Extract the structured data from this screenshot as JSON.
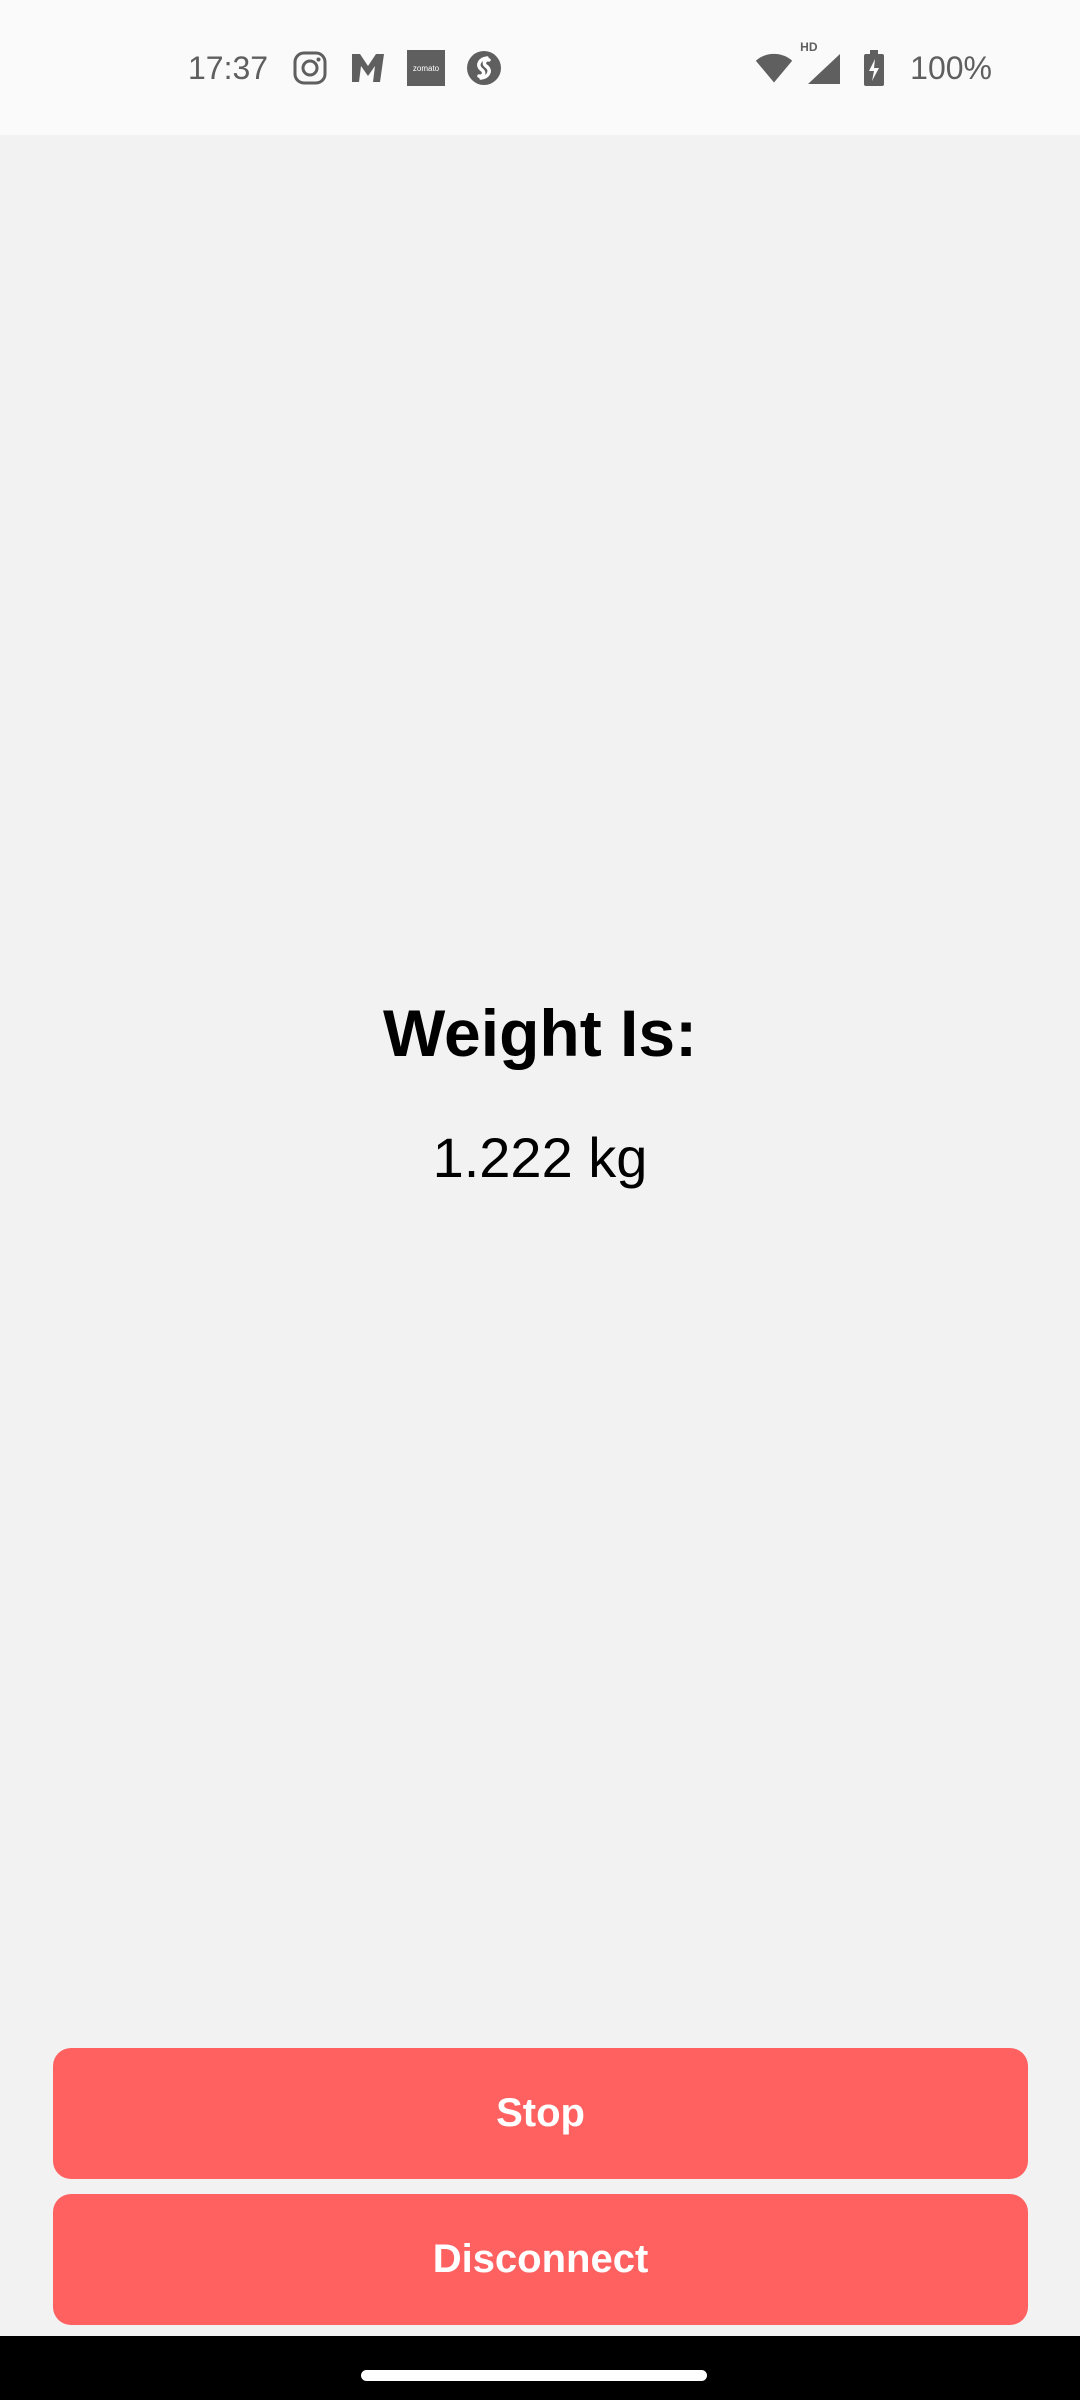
{
  "status_bar": {
    "time": "17:37",
    "notification_icons": [
      "instagram-icon",
      "myntra-icon",
      "zomato-icon",
      "shazam-icon"
    ],
    "zomato_text": "zomato",
    "network_badge": "HD",
    "battery": "100%"
  },
  "main": {
    "title": "Weight Is:",
    "value": "1.222 kg"
  },
  "buttons": {
    "stop_label": "Stop",
    "disconnect_label": "Disconnect"
  },
  "colors": {
    "button_bg": "#ff6161",
    "background": "#f2f2f2",
    "status_bar_bg": "#fafafa",
    "icon_gray": "#5f5f5f"
  }
}
